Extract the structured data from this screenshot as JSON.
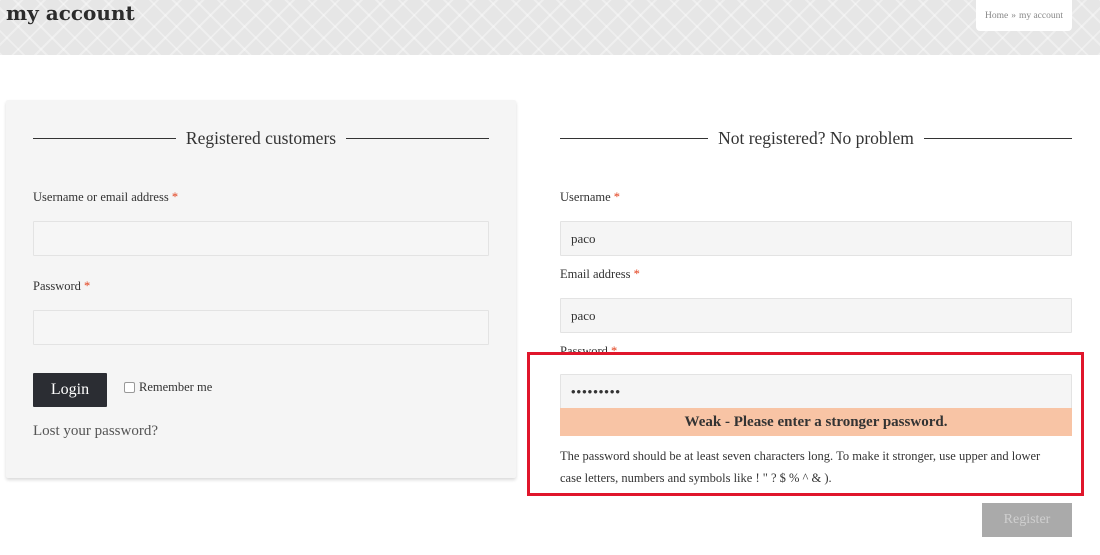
{
  "header": {
    "title": "my account",
    "breadcrumb": {
      "home": "Home",
      "separator": "»",
      "current": "my account"
    }
  },
  "login": {
    "heading": "Registered customers",
    "username_label": "Username or email address",
    "required_mark": "*",
    "username_value": "",
    "password_label": "Password",
    "password_value": "",
    "login_button": "Login",
    "remember_label": "Remember me",
    "lost_password": "Lost your password?"
  },
  "register": {
    "heading": "Not registered? No problem",
    "username_label": "Username",
    "username_value": "paco",
    "email_label": "Email address",
    "email_value": "paco",
    "password_label": "Password",
    "password_value": "•••••••••",
    "strength_text": "Weak - Please enter a stronger password.",
    "hint": "The password should be at least seven characters long. To make it stronger, use upper and lower case letters, numbers and symbols like ! \" ? $ % ^ & ).",
    "register_button": "Register"
  },
  "colors": {
    "required": "#e2401c",
    "strength_weak_bg": "#f8c4a5",
    "highlight_border": "#e0162b",
    "button_dark": "#2b2d33"
  }
}
